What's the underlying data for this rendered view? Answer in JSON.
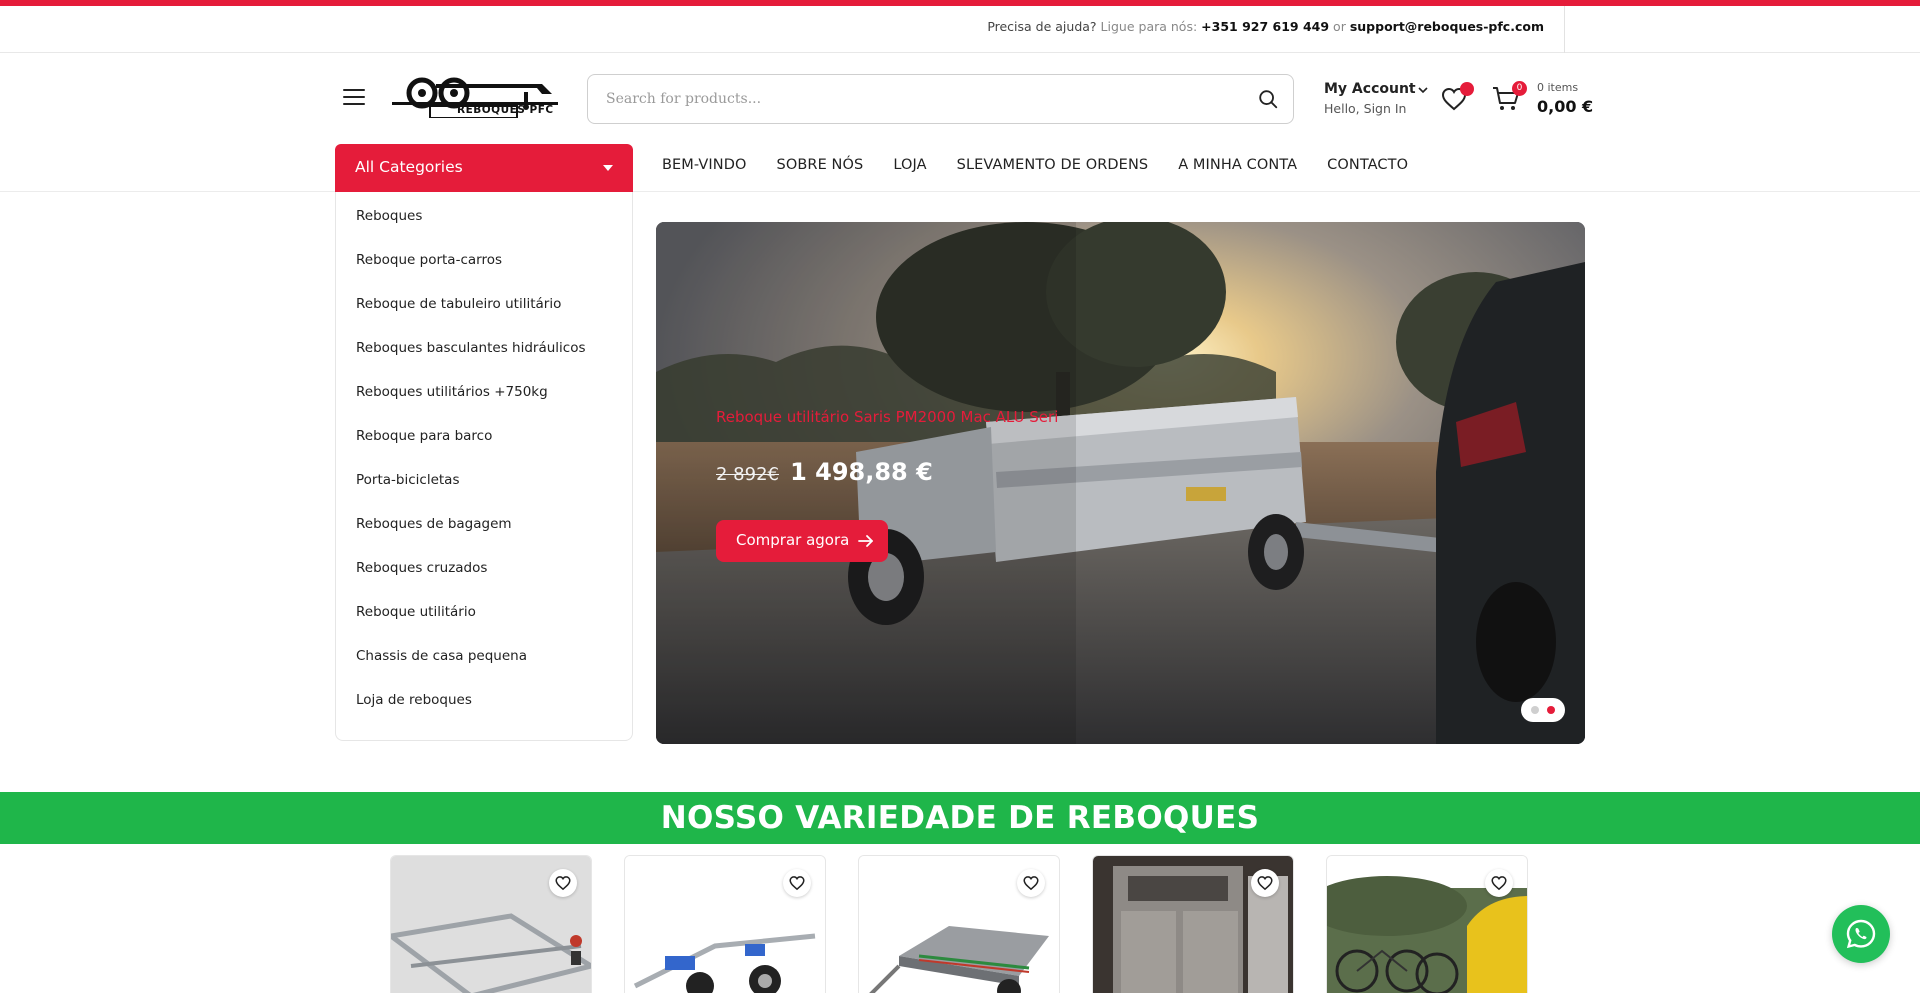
{
  "topbar": {
    "help_label": "Precisa de ajuda?",
    "call_label": "Ligue para nós:",
    "phone": "+351 927 619 449",
    "or_label": "or",
    "email": "support@reboques-pfc.com"
  },
  "header": {
    "logo_text": "REBOQUES PFC",
    "search_placeholder": "Search for products...",
    "account_title": "My Account",
    "account_subtitle": "Hello, Sign In",
    "cart_count": "0",
    "cart_items": "0 items",
    "cart_total": "0,00 €"
  },
  "nav": {
    "categories_label": "All Categories",
    "links": [
      "BEM-VINDO",
      "SOBRE NÓS",
      "LOJA",
      "SLEVAMENTO DE ORDENS",
      "A MINHA CONTA",
      "CONTACTO"
    ]
  },
  "categories": [
    "Reboques",
    "Reboque porta-carros",
    "Reboque de tabuleiro utilitário",
    "Reboques basculantes hidráulicos",
    "Reboques utilitários +750kg",
    "Reboque para barco",
    "Porta-bicicletas",
    "Reboques de bagagem",
    "Reboques cruzados",
    "Reboque utilitário",
    "Chassis de casa pequena",
    "Loja de reboques"
  ],
  "hero": {
    "title": "Reboque utilitário Saris PM2000 Mac ALU Seri",
    "old_price": "2 892€",
    "new_price": "1 498,88 €",
    "button_label": "Comprar agora"
  },
  "banner": {
    "title": "NOSSO VARIEDADE DE REBOQUES"
  },
  "colors": {
    "accent": "#e51c3a",
    "banner_green": "#1fb64a",
    "whatsapp_green": "#22bf5a"
  }
}
